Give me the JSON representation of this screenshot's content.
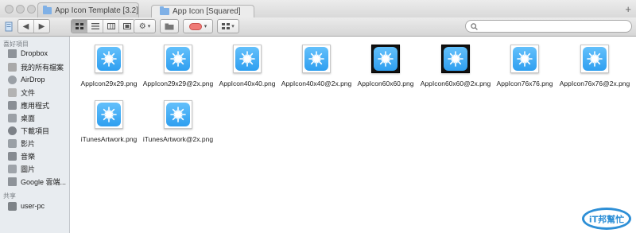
{
  "window": {
    "tabs": [
      {
        "label": "App Icon Template [3.2]",
        "active": false
      },
      {
        "label": "App Icon [Squared]",
        "active": true
      }
    ],
    "add_tab_glyph": "+"
  },
  "toolbar": {
    "back_glyph": "◀",
    "forward_glyph": "▶",
    "view_modes": [
      "icon-view",
      "list-view",
      "column-view",
      "coverflow-view"
    ],
    "selected_view": "icon-view",
    "action_glyph": "⚙",
    "tag_color": "#ef7a76",
    "search_placeholder": ""
  },
  "sidebar": {
    "favorites_heading": "喜好項目",
    "favorites": [
      {
        "label": "Dropbox",
        "icon": "folder-icon"
      },
      {
        "label": "我的所有檔案",
        "icon": "all-files-icon"
      },
      {
        "label": "AirDrop",
        "icon": "airdrop-icon"
      },
      {
        "label": "文件",
        "icon": "documents-icon"
      },
      {
        "label": "應用程式",
        "icon": "applications-icon"
      },
      {
        "label": "桌面",
        "icon": "desktop-icon"
      },
      {
        "label": "下載項目",
        "icon": "downloads-icon"
      },
      {
        "label": "影片",
        "icon": "movies-icon"
      },
      {
        "label": "音樂",
        "icon": "music-icon"
      },
      {
        "label": "圖片",
        "icon": "pictures-icon"
      },
      {
        "label": "Google 雲端...",
        "icon": "folder-icon"
      }
    ],
    "shared_heading": "共享",
    "shared": [
      {
        "label": "user-pc",
        "icon": "computer-icon"
      }
    ]
  },
  "files": [
    {
      "name": "AppIcon29x29.png",
      "dark": false
    },
    {
      "name": "AppIcon29x29@2x.png",
      "dark": false
    },
    {
      "name": "AppIcon40x40.png",
      "dark": false
    },
    {
      "name": "AppIcon40x40@2x.png",
      "dark": false
    },
    {
      "name": "AppIcon60x60.png",
      "dark": true
    },
    {
      "name": "AppIcon60x60@2x.png",
      "dark": true
    },
    {
      "name": "AppIcon76x76.png",
      "dark": false
    },
    {
      "name": "AppIcon76x76@2x.png",
      "dark": false
    },
    {
      "name": "iTunesArtwork.png",
      "dark": false
    },
    {
      "name": "iTunesArtwork@2x.png",
      "dark": false
    }
  ],
  "watermark": {
    "text": "iT邦幫忙",
    "color": "#2e8fd6"
  }
}
